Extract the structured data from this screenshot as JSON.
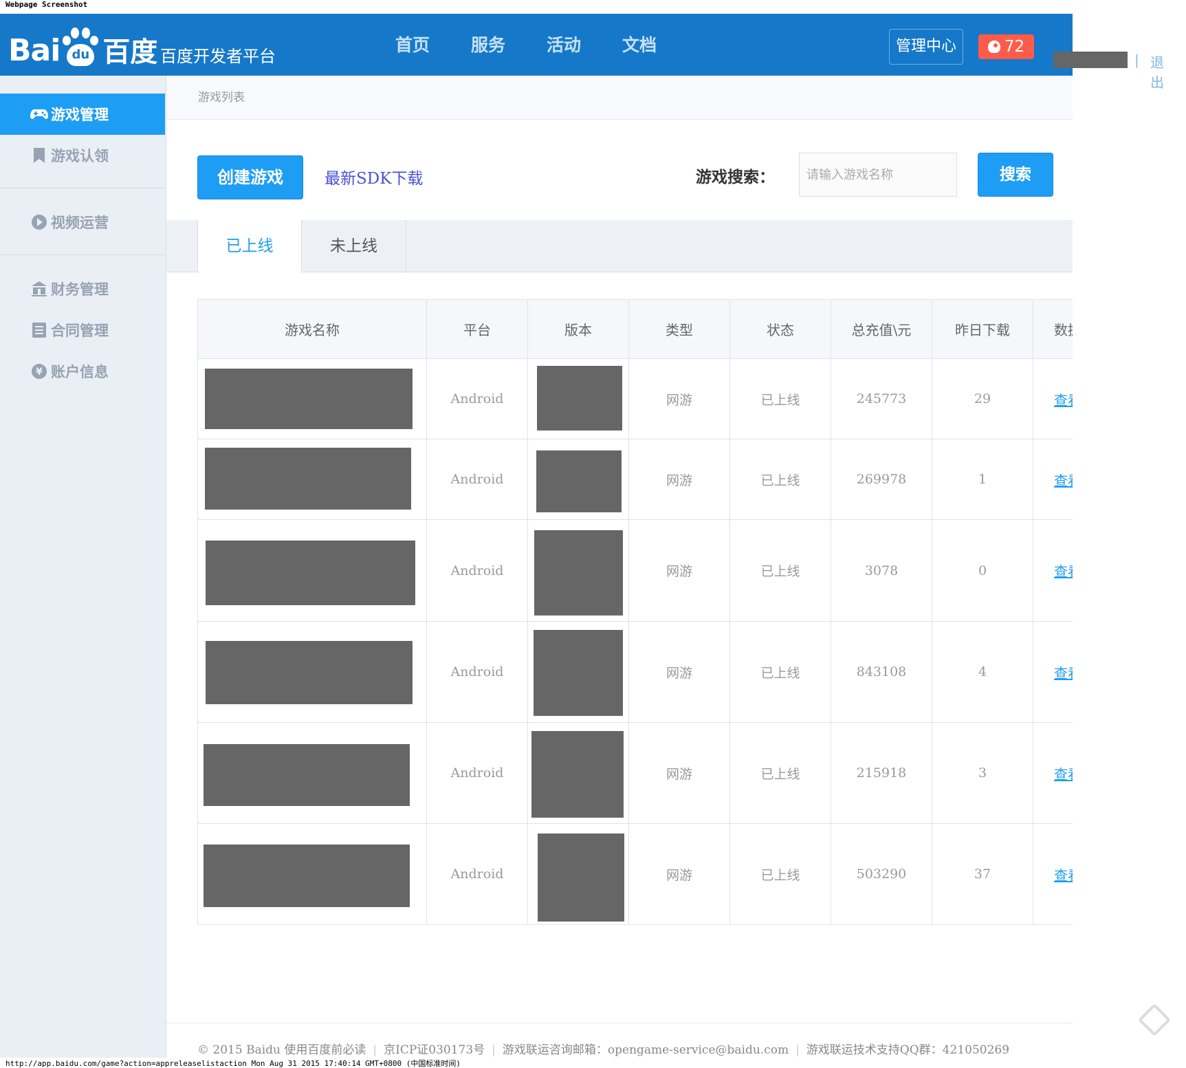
{
  "screenshot": {
    "label": "Webpage Screenshot",
    "url_line": "http://app.baidu.com/game?action=appreleaselistaction Mon Aug 31 2015 17:40:14 GMT+0800 (中国标准时间)"
  },
  "header": {
    "logo_latin": "Bai",
    "logo_paw_text": "du",
    "logo_cn": "百度",
    "site_name": "百度开发者平台",
    "nav": [
      "首页",
      "服务",
      "活动",
      "文档"
    ],
    "mgmt_label": "管理中心",
    "notify_count": "72",
    "separator": "|",
    "logout_label": "退出"
  },
  "sidebar": {
    "items": [
      {
        "label": "游戏管理",
        "icon": "gamepad-icon",
        "active": true
      },
      {
        "label": "游戏认领",
        "icon": "bookmark-icon"
      },
      {
        "label": "视频运营",
        "icon": "play-circle-icon"
      },
      {
        "label": "财务管理",
        "icon": "bank-icon"
      },
      {
        "label": "合同管理",
        "icon": "document-icon"
      },
      {
        "label": "账户信息",
        "icon": "yen-circle-icon"
      }
    ]
  },
  "breadcrumb": "游戏列表",
  "toolbar": {
    "create_label": "创建游戏",
    "sdk_link": "最新SDK下载",
    "search_label": "游戏搜索：",
    "search_placeholder": "请输入游戏名称",
    "search_button": "搜索"
  },
  "tabs": [
    "已上线",
    "未上线"
  ],
  "table": {
    "headers": [
      "游戏名称",
      "平台",
      "版本",
      "类型",
      "状态",
      "总充值\\元",
      "昨日下载",
      "数据"
    ],
    "rows": [
      {
        "platform": "Android",
        "type": "网游",
        "status": "已上线",
        "recharge": "245773",
        "downloads": "29",
        "action": "查看"
      },
      {
        "platform": "Android",
        "type": "网游",
        "status": "已上线",
        "recharge": "269978",
        "downloads": "1",
        "action": "查看"
      },
      {
        "platform": "Android",
        "type": "网游",
        "status": "已上线",
        "recharge": "3078",
        "downloads": "0",
        "action": "查看"
      },
      {
        "platform": "Android",
        "type": "网游",
        "status": "已上线",
        "recharge": "843108",
        "downloads": "4",
        "action": "查看"
      },
      {
        "platform": "Android",
        "type": "网游",
        "status": "已上线",
        "recharge": "215918",
        "downloads": "3",
        "action": "查看"
      },
      {
        "platform": "Android",
        "type": "网游",
        "status": "已上线",
        "recharge": "503290",
        "downloads": "37",
        "action": "查看"
      }
    ]
  },
  "footer": {
    "copyright": "© 2015 Baidu 使用百度前必读",
    "icp": "京ICP证030173号",
    "email": "游戏联运咨询邮箱：opengame-service@baidu.com",
    "qq": "游戏联运技术支持QQ群：421050269"
  },
  "colors": {
    "header_bg": "#1678c8",
    "accent": "#1e9df4",
    "notify": "#ff5b4a",
    "sidebar_bg": "#eaeff5"
  }
}
